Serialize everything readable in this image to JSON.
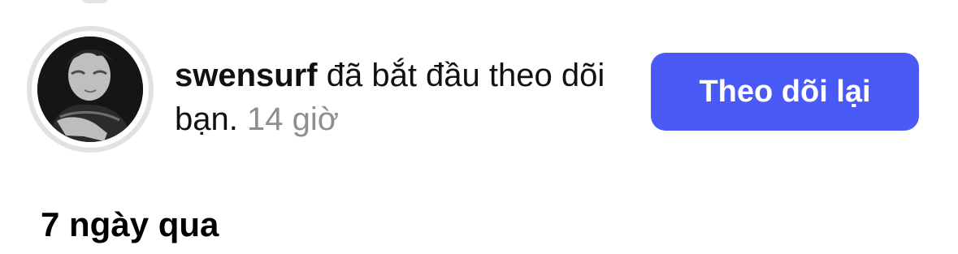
{
  "notification": {
    "username": "swensurf",
    "message": " đã bắt đầu theo dõi bạn.",
    "time": " 14 giờ",
    "follow_back_label": "Theo dõi lại"
  },
  "section": {
    "title": "7 ngày qua"
  },
  "colors": {
    "button_background": "#4a5af6",
    "button_text": "#ffffff",
    "timestamp": "#8e8e8e"
  }
}
